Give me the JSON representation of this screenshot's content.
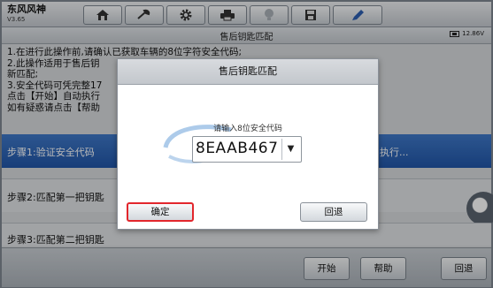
{
  "app": {
    "brand": "东风风神",
    "version": "V3.65"
  },
  "toolbar": {
    "icons": [
      "home-icon",
      "tool-icon",
      "gear-icon",
      "printer-icon",
      "lightbulb-icon",
      "save-icon",
      "pen-icon"
    ]
  },
  "page": {
    "title": "售后钥匙匹配",
    "battery": "12.86V"
  },
  "info_lines": [
    "1.在进行此操作前,请确认已获取车辆的8位字符安全代码;",
    "2.此操作适用于售后钥",
    "新匹配;",
    "3.安全代码可凭完整17",
    "点击【开始】自动执行",
    "如有疑惑请点击【帮助"
  ],
  "steps": [
    {
      "label": "步骤1:验证安全代码",
      "extra": "执行..."
    },
    {
      "label": "步骤2:匹配第一把钥匙"
    },
    {
      "label": "步骤3:匹配第二把钥匙"
    }
  ],
  "bottom": {
    "start": "开始",
    "help": "帮助",
    "back": "回退"
  },
  "dialog": {
    "title": "售后钥匙匹配",
    "prompt": "请输入8位安全代码",
    "code": "8EAAB467",
    "dropdown_symbol": "▼",
    "ok": "确定",
    "cancel": "回退"
  },
  "colors": {
    "step_active": "#2f66b8",
    "highlight": "#e2262c"
  }
}
